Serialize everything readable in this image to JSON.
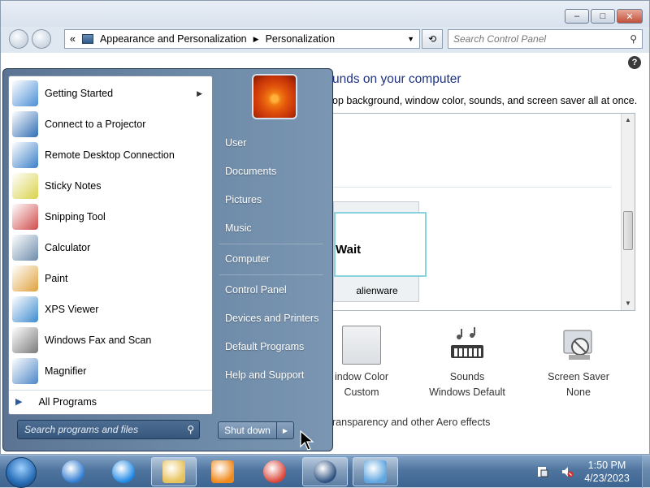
{
  "window": {
    "breadcrumb": [
      "Appearance and Personalization",
      "Personalization"
    ],
    "breadcrumb_prefix": "«",
    "search_placeholder": "Search Control Panel",
    "title": "unds on your computer",
    "subtitle": "op background, window color, sounds, and screen saver all at once.",
    "theme": {
      "preview_text": "Wait",
      "name": "alienware"
    },
    "options": [
      {
        "title": "indow Color",
        "value": "Custom",
        "icon": "window-color-icon"
      },
      {
        "title": "Sounds",
        "value": "Windows Default",
        "icon": "sounds-icon"
      },
      {
        "title": "Screen Saver",
        "value": "None",
        "icon": "screen-saver-icon"
      }
    ],
    "aero_link": "ransparency and other Aero effects",
    "buttons": {
      "minimize": "–",
      "maximize": "□",
      "close": "✕",
      "help": "?"
    }
  },
  "start_menu": {
    "programs": [
      {
        "label": "Getting Started",
        "icon": "getting-started-icon",
        "has_submenu": true,
        "color": "#4a8fd6"
      },
      {
        "label": "Connect to a Projector",
        "icon": "projector-icon",
        "has_submenu": false,
        "color": "#2f6db3"
      },
      {
        "label": "Remote Desktop Connection",
        "icon": "remote-desktop-icon",
        "has_submenu": false,
        "color": "#3a7fc8"
      },
      {
        "label": "Sticky Notes",
        "icon": "sticky-notes-icon",
        "has_submenu": false,
        "color": "#d9d24a"
      },
      {
        "label": "Snipping Tool",
        "icon": "snipping-tool-icon",
        "has_submenu": false,
        "color": "#d04a4a"
      },
      {
        "label": "Calculator",
        "icon": "calculator-icon",
        "has_submenu": false,
        "color": "#6d8cab"
      },
      {
        "label": "Paint",
        "icon": "paint-icon",
        "has_submenu": false,
        "color": "#e0a13c"
      },
      {
        "label": "XPS Viewer",
        "icon": "xps-viewer-icon",
        "has_submenu": false,
        "color": "#3d8bd0"
      },
      {
        "label": "Windows Fax and Scan",
        "icon": "fax-scan-icon",
        "has_submenu": false,
        "color": "#7a7a7a"
      },
      {
        "label": "Magnifier",
        "icon": "magnifier-icon",
        "has_submenu": false,
        "color": "#4d86c7"
      }
    ],
    "all_programs": "All Programs",
    "search_placeholder": "Search programs and files",
    "right_items": [
      "User",
      "Documents",
      "Pictures",
      "Music",
      "Computer",
      "Control Panel",
      "Devices and Printers",
      "Default Programs",
      "Help and Support"
    ],
    "shutdown": "Shut down"
  },
  "taskbar": {
    "apps": [
      {
        "name": "windows-update",
        "active": false,
        "color": "#2f7bd1"
      },
      {
        "name": "internet-explorer",
        "active": false,
        "color": "#1e88e5"
      },
      {
        "name": "file-explorer",
        "active": true,
        "color": "#e8c25a"
      },
      {
        "name": "media-player",
        "active": false,
        "color": "#f08a1c"
      },
      {
        "name": "chrome",
        "active": false,
        "color": "#db4437"
      },
      {
        "name": "alienware",
        "active": true,
        "color": "#2b4f7e"
      },
      {
        "name": "control-panel",
        "active": true,
        "color": "#5fa6e0"
      }
    ],
    "time": "1:50 PM",
    "date": "4/23/2023"
  }
}
